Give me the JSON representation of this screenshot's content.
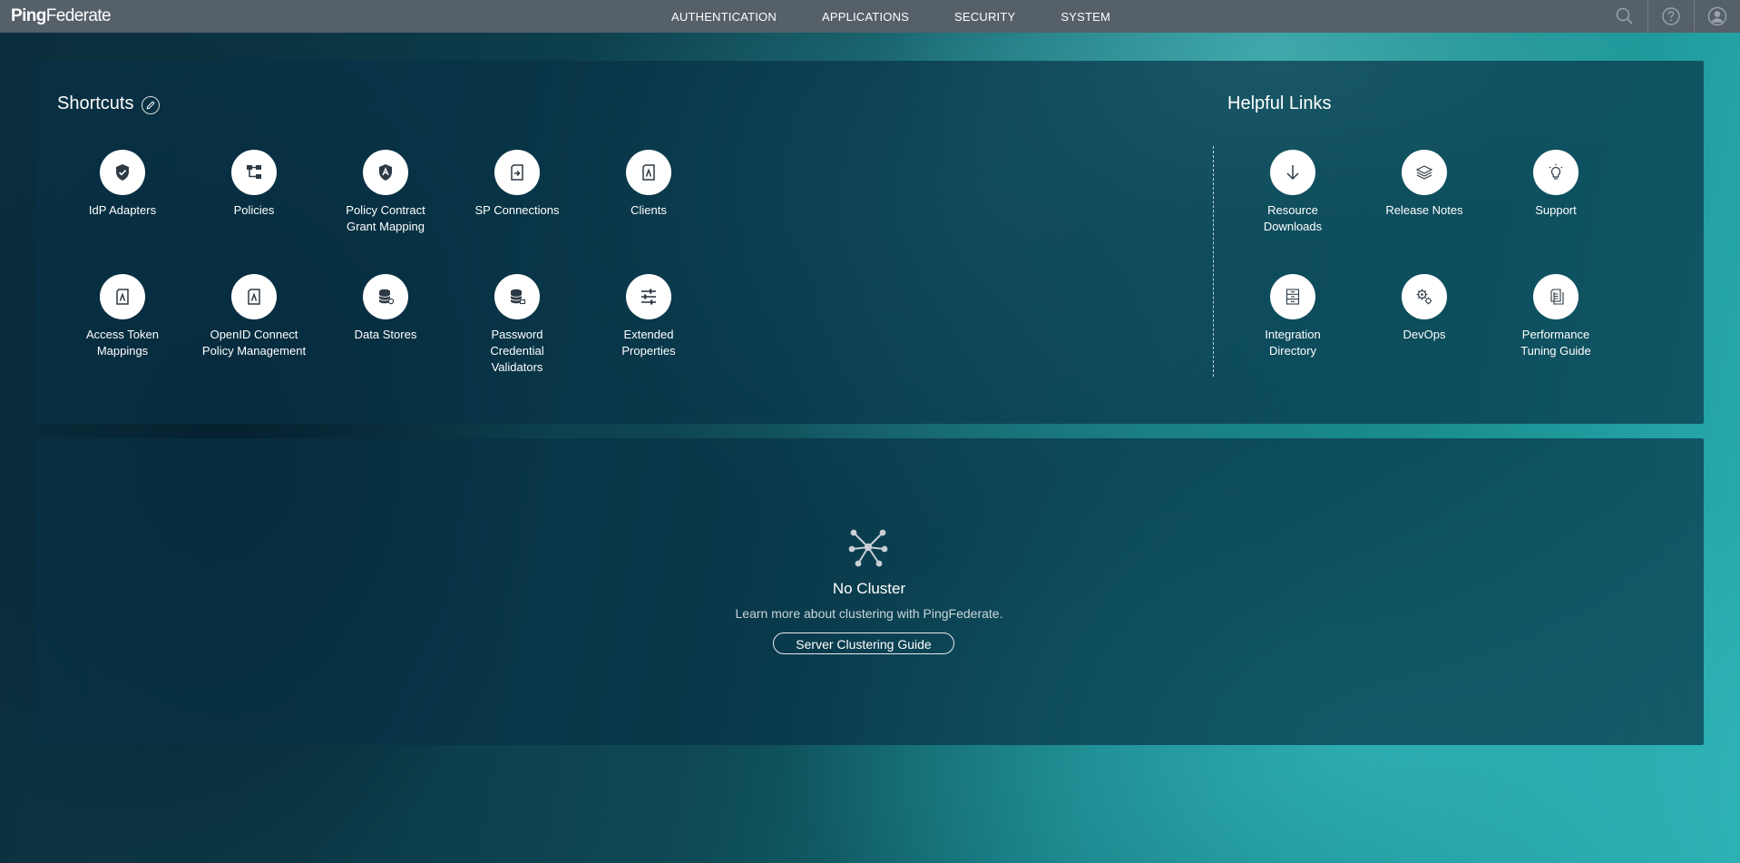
{
  "app": {
    "logo_bold": "Ping",
    "logo_light": "Federate"
  },
  "nav": {
    "items": [
      "AUTHENTICATION",
      "APPLICATIONS",
      "SECURITY",
      "SYSTEM"
    ]
  },
  "topIcons": [
    "search-icon",
    "help-icon",
    "user-icon"
  ],
  "shortcuts": {
    "title": "Shortcuts",
    "items": [
      {
        "label": "IdP Adapters",
        "icon": "shield-check-icon"
      },
      {
        "label": "Policies",
        "icon": "policy-tree-icon"
      },
      {
        "label": "Policy Contract\nGrant Mapping",
        "icon": "shield-badge-icon"
      },
      {
        "label": "SP Connections",
        "icon": "document-arrow-icon"
      },
      {
        "label": "Clients",
        "icon": "document-key-icon"
      },
      {
        "label": "Access Token\nMappings",
        "icon": "document-key-icon"
      },
      {
        "label": "OpenID Connect\nPolicy Management",
        "icon": "document-key-icon"
      },
      {
        "label": "Data Stores",
        "icon": "database-icon"
      },
      {
        "label": "Password\nCredential\nValidators",
        "icon": "database-lock-icon"
      },
      {
        "label": "Extended\nProperties",
        "icon": "sliders-icon"
      }
    ]
  },
  "helpfulLinks": {
    "title": "Helpful Links",
    "items": [
      {
        "label": "Resource\nDownloads",
        "icon": "download-arrow-icon"
      },
      {
        "label": "Release Notes",
        "icon": "layers-icon"
      },
      {
        "label": "Support",
        "icon": "lightbulb-icon"
      },
      {
        "label": "Integration\nDirectory",
        "icon": "cabinet-icon"
      },
      {
        "label": "DevOps",
        "icon": "gears-icon"
      },
      {
        "label": "Performance\nTuning Guide",
        "icon": "documents-icon"
      }
    ]
  },
  "cluster": {
    "title": "No Cluster",
    "text": "Learn more about clustering with PingFederate.",
    "button": "Server Clustering Guide"
  },
  "colors": {
    "navbar": "#566069",
    "panel": "#083046",
    "accent": "#ffffff"
  }
}
